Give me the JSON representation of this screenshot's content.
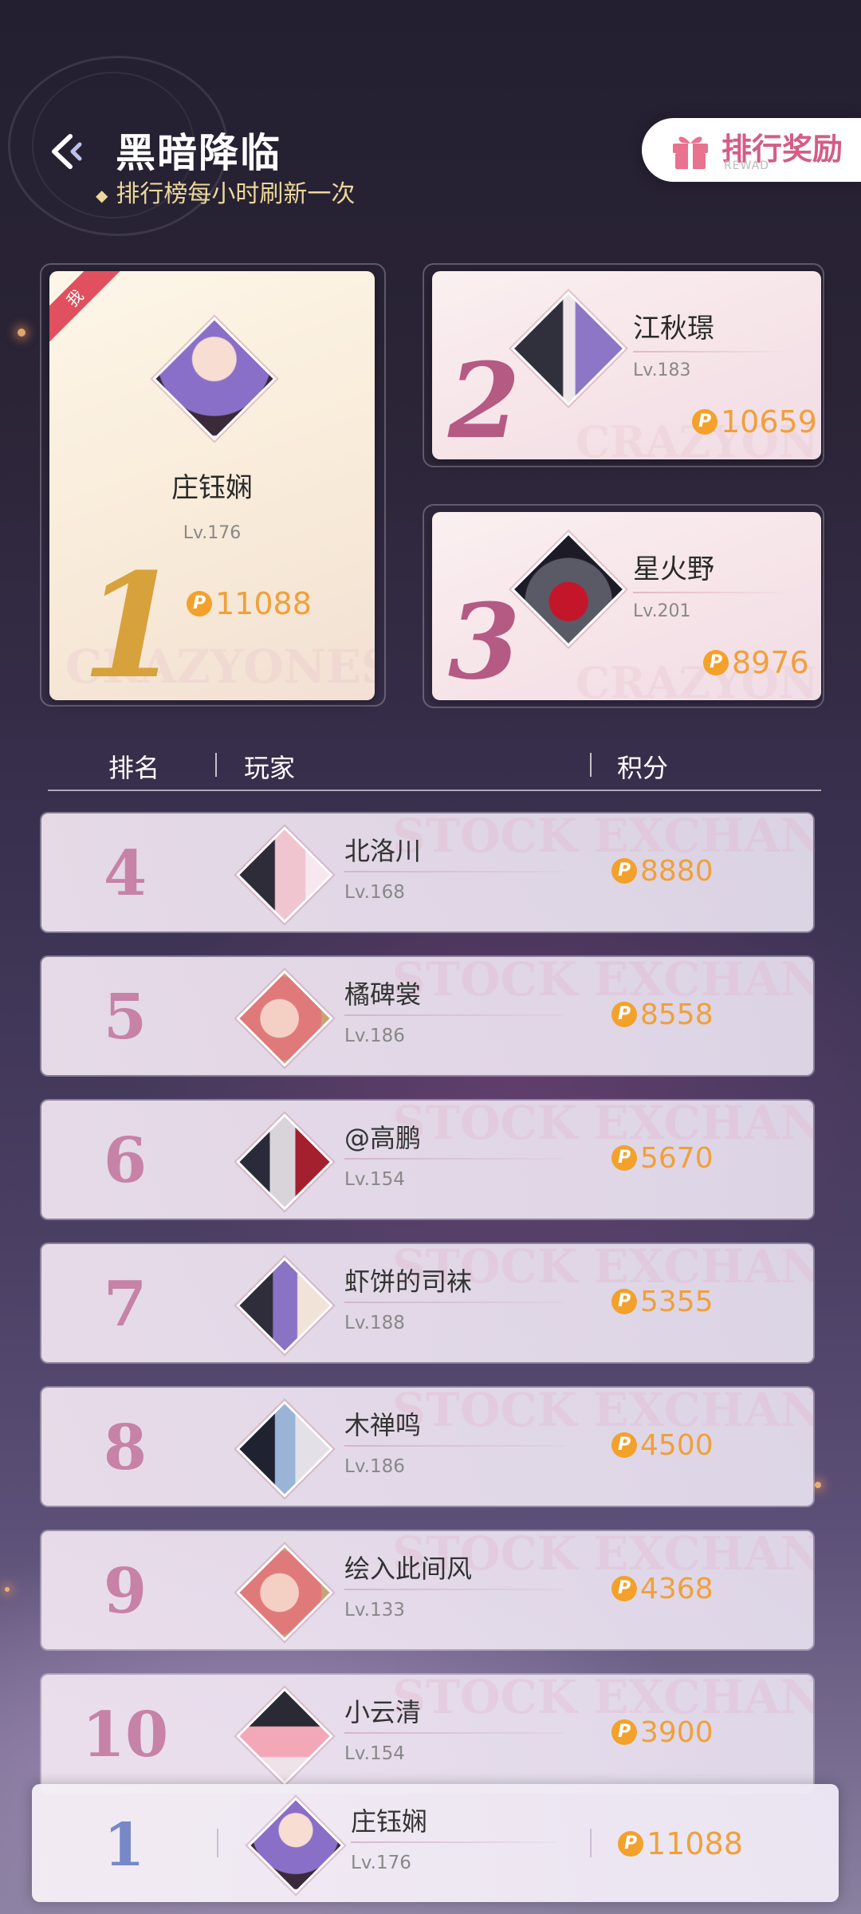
{
  "header": {
    "title": "黑暗降临",
    "subtitle": "排行榜每小时刷新一次",
    "reward_button": {
      "label": "排行奖励",
      "sub_label": "REWAD"
    }
  },
  "top3": [
    {
      "rank": "1",
      "name": "庄钰娴",
      "level": "Lv.176",
      "score": "11088",
      "is_me": true,
      "me_label": "我",
      "watermark": "CRAZYONES"
    },
    {
      "rank": "2",
      "name": "江秋璟",
      "level": "Lv.183",
      "score": "10659",
      "watermark": "CRAZYONES"
    },
    {
      "rank": "3",
      "name": "星火野",
      "level": "Lv.201",
      "score": "8976",
      "watermark": "CRAZYONES"
    }
  ],
  "table_header": {
    "rank": "排名",
    "player": "玩家",
    "score": "积分"
  },
  "list_watermark": "STOCK EXCHANGE",
  "rows": [
    {
      "rank": "4",
      "name": "北洛川",
      "level": "Lv.168",
      "score": "8880"
    },
    {
      "rank": "5",
      "name": "橘碑裳",
      "level": "Lv.186",
      "score": "8558"
    },
    {
      "rank": "6",
      "name": "@高鹏",
      "level": "Lv.154",
      "score": "5670"
    },
    {
      "rank": "7",
      "name": "虾饼的司袜",
      "level": "Lv.188",
      "score": "5355"
    },
    {
      "rank": "8",
      "name": "木禅鸣",
      "level": "Lv.186",
      "score": "4500"
    },
    {
      "rank": "9",
      "name": "绘入此间风",
      "level": "Lv.133",
      "score": "4368"
    },
    {
      "rank": "10",
      "name": "小云清",
      "level": "Lv.154",
      "score": "3900"
    }
  ],
  "my_rank": {
    "rank": "1",
    "name": "庄钰娴",
    "level": "Lv.176",
    "score": "11088"
  },
  "colors": {
    "accent_gold": "#f0a03b",
    "rank_pink": "#c782a8",
    "my_rank_blue": "#7787c8",
    "reward_pink": "#d45d84"
  },
  "icons": {
    "back": "back-arrow-icon",
    "reward": "gift-icon",
    "coin": "points-coin-icon"
  }
}
